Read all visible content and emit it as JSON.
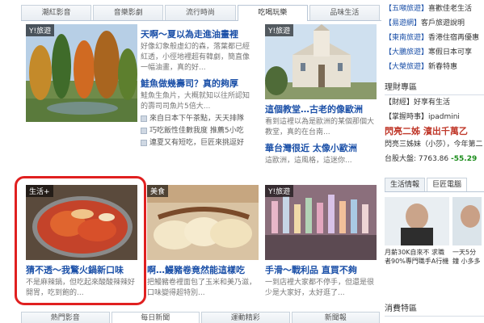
{
  "tabs": [
    "潮紅影音",
    "音樂影劇",
    "流行時尚",
    "吃喝玩樂",
    "品味生活"
  ],
  "active_tab_index": 3,
  "cards": {
    "c1": {
      "tag": "Y!旅遊",
      "title": "",
      "desc": ""
    },
    "c2": {
      "title": "天啊～夏以為走進油畫裡",
      "desc": "好像幻象般虛幻的森，落葉都已經紅透，小徑地裡超有韓劇，簡直像一幅油畫，真的好...",
      "title2": "鮭魚做幾壽司？真的夠厚",
      "desc2": "鮭魚生魚片，大概就知以往所認知的壽司司魚片5倍大...",
      "subs": [
        "來自日本下午茶點，天天排隊",
        "巧吃飯性佳數我度 推薦5小吃",
        "連夏又有短吃，巨匠來挑逗好"
      ]
    },
    "c3": {
      "tag": "Y!旅遊",
      "title": "這個教堂…古老的像歐洲",
      "desc": "看到這裡以為是歐洲的某個那個大教堂，真的在台南...",
      "title2": "華台灣很近 太像小歐洲",
      "desc2": "這歐洲，這風格，這迷你..."
    },
    "c4": {
      "tag": "生活+",
      "title": "猜不透～我驚火鍋新口味",
      "desc": "不是麻辣鍋，但吃起來酸酸辣辣好開胃，吃到飽的..."
    },
    "c5": {
      "tag": "美食",
      "title": "啊…鰻豬卷竟然能這樣吃",
      "desc": "把鰻豬卷裡面包了玉米和美乃滋，口味變得超特別..."
    },
    "c6": {
      "tag": "Y!旅遊",
      "title": "手滑～戰利品 直買不夠",
      "desc": "一到店裡大家都不停手，但還是很少是大家好，太好逛了..."
    }
  },
  "bottom_tabs": [
    "熱門影音",
    "每日新聞",
    "運動精彩",
    "新聞報"
  ],
  "bottom_active_index": 1,
  "right": {
    "news": [
      {
        "cat": "【五噸旅遊】",
        "text": "喜歡佳老生活"
      },
      {
        "cat": "【易遊網】",
        "text": "客戶旅遊說明"
      },
      {
        "cat": "【東南旅遊】",
        "text": "香港住宿再優惠"
      },
      {
        "cat": "【大鵬旅遊】",
        "text": "寒假日本可享"
      },
      {
        "cat": "【大榮旅遊】",
        "text": "新春特惠"
      }
    ],
    "finance_title": "理財專區",
    "finance_items": [
      "【財經】好享有生活",
      "【掌握時事】ipadmini"
    ],
    "stock_title": "閃亮二姊 濱出千萬乙",
    "stock_desc": "閃亮三姊妹（小莎），今年第二",
    "index_label": "台股大盤:",
    "index_value": "7763.86",
    "index_change": "-55.29",
    "tabs2": [
      "生活情報",
      "巨匠電腦"
    ],
    "promo1": "月薪30K自來不 求職者90%專門職手A行機",
    "promo2": "一天5分鐘 小多多",
    "bottom_label": "消費特區"
  },
  "colors": {
    "accent": "#1b50a8",
    "highlight": "#e02020",
    "down": "#1a8c1a",
    "tab_bg": "#e8edf2"
  }
}
